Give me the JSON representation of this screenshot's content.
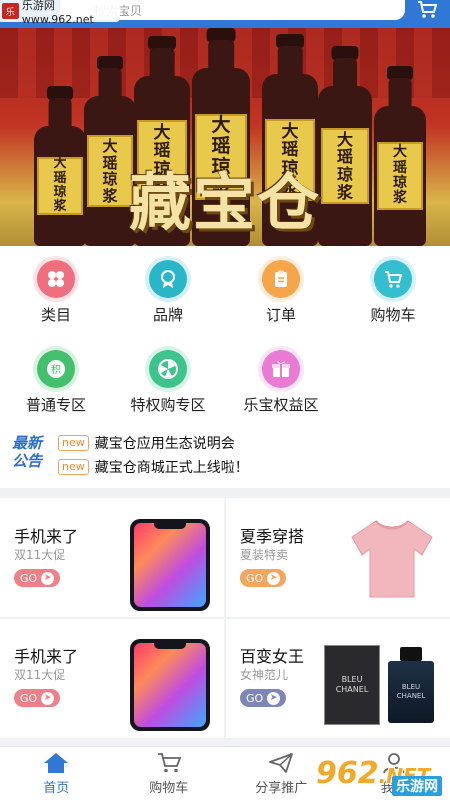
{
  "watermark_top": {
    "text": "乐游网www.962.net",
    "logo": "乐"
  },
  "search": {
    "placeholder": "搜索宝贝"
  },
  "banner": {
    "title": "藏宝仓",
    "bottle_label": [
      "大",
      "瑶",
      "琼",
      "浆"
    ]
  },
  "categories": [
    {
      "label": "类目",
      "icon": "clover-icon",
      "color": "#f06e7e"
    },
    {
      "label": "品牌",
      "icon": "ribbon-badge-icon",
      "color": "#2ab6c9"
    },
    {
      "label": "订单",
      "icon": "clipboard-icon",
      "color": "#f6a54a"
    },
    {
      "label": "购物车",
      "icon": "cart-icon",
      "color": "#34bfd0"
    },
    {
      "label": "普通专区",
      "icon": "coin-icon",
      "color": "#43c06d"
    },
    {
      "label": "特权购专区",
      "icon": "fan-icon",
      "color": "#3dc48b"
    },
    {
      "label": "乐宝权益区",
      "icon": "gift-icon",
      "color": "#e97bd4"
    }
  ],
  "notice": {
    "brand_line1": "最新",
    "brand_line2": "公告",
    "tag": "new",
    "items": [
      "藏宝仓应用生态说明会",
      "藏宝仓商城正式上线啦！"
    ]
  },
  "products": [
    {
      "title": "手机来了",
      "subtitle": "双11大促",
      "go": "GO",
      "go_color": "#f07f88",
      "image": "phone"
    },
    {
      "title": "夏季穿搭",
      "subtitle": "夏装特卖",
      "go": "GO",
      "go_color": "#f6a55a",
      "image": "shirt"
    },
    {
      "title": "手机来了",
      "subtitle": "双11大促",
      "go": "GO",
      "go_color": "#f07f88",
      "image": "phone"
    },
    {
      "title": "百变女王",
      "subtitle": "女神范儿",
      "go": "GO",
      "go_color": "#7e86b8",
      "image": "perfume"
    }
  ],
  "perfume_label": {
    "brand": "BLEU",
    "maker": "CHANEL"
  },
  "tabs": [
    {
      "label": "首页",
      "icon": "home-icon",
      "active": true
    },
    {
      "label": "购物车",
      "icon": "cart-icon"
    },
    {
      "label": "分享推广",
      "icon": "share-plane-icon"
    },
    {
      "label": "我的",
      "icon": "user-icon"
    }
  ],
  "watermark_bottom": {
    "big": "962",
    "net": ".NET",
    "small": "乐游网"
  }
}
